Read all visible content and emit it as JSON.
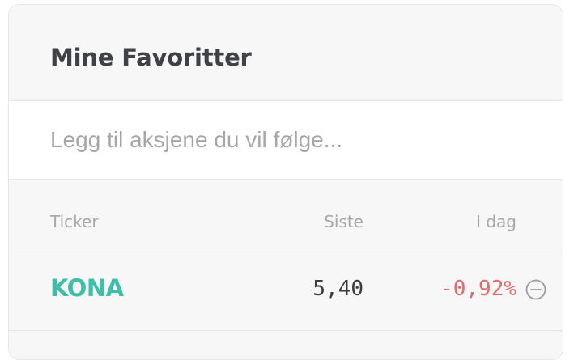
{
  "favorites": {
    "title": "Mine Favoritter",
    "search": {
      "placeholder": "Legg til aksjene du vil følge...",
      "value": ""
    },
    "columns": {
      "ticker": "Ticker",
      "last": "Siste",
      "today": "I dag"
    },
    "rows": [
      {
        "ticker": "KONA",
        "last": "5,40",
        "today": "-0,92%",
        "remove_icon": "minus-circle-icon"
      }
    ],
    "colors": {
      "ticker": "#3fbfa9",
      "negative": "#e46a6d",
      "title": "#3f4146",
      "muted": "#a7a8ab"
    }
  }
}
